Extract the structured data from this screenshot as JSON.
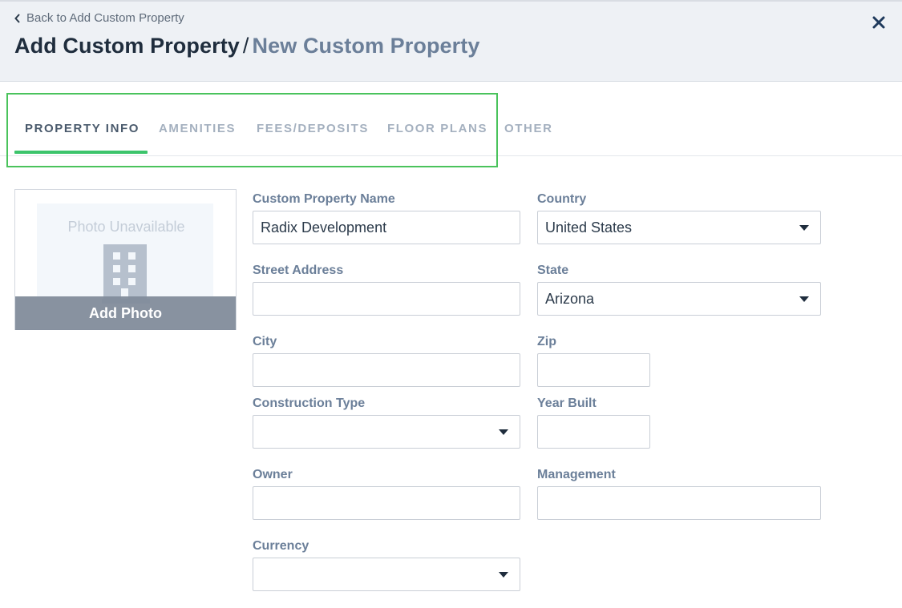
{
  "header": {
    "back_label": "Back to Add Custom Property",
    "title": "Add Custom Property",
    "separator": "/",
    "subtitle": "New Custom Property"
  },
  "tabs": [
    {
      "label": "PROPERTY INFO",
      "active": true
    },
    {
      "label": "AMENITIES",
      "active": false
    },
    {
      "label": "FEES/DEPOSITS",
      "active": false
    },
    {
      "label": "FLOOR PLANS",
      "active": false
    },
    {
      "label": "OTHER",
      "active": false
    }
  ],
  "photo": {
    "unavailable_text": "Photo Unavailable",
    "add_label": "Add Photo"
  },
  "form": {
    "name": {
      "label": "Custom Property Name",
      "value": "Radix Development"
    },
    "country": {
      "label": "Country",
      "value": "United States"
    },
    "street": {
      "label": "Street Address",
      "value": ""
    },
    "state": {
      "label": "State",
      "value": "Arizona"
    },
    "city": {
      "label": "City",
      "value": ""
    },
    "zip": {
      "label": "Zip",
      "value": ""
    },
    "construction": {
      "label": "Construction Type",
      "value": ""
    },
    "year": {
      "label": "Year Built",
      "value": ""
    },
    "owner": {
      "label": "Owner",
      "value": ""
    },
    "management": {
      "label": "Management",
      "value": ""
    },
    "currency": {
      "label": "Currency",
      "value": ""
    }
  },
  "colors": {
    "accent": "#3cc46b",
    "highlight": "#4ac35c",
    "label": "#6b7f99",
    "inactive_tab": "#a4b0bf"
  },
  "icons": [
    "chevron-left-icon",
    "close-icon",
    "building-icon",
    "caret-down-icon"
  ]
}
